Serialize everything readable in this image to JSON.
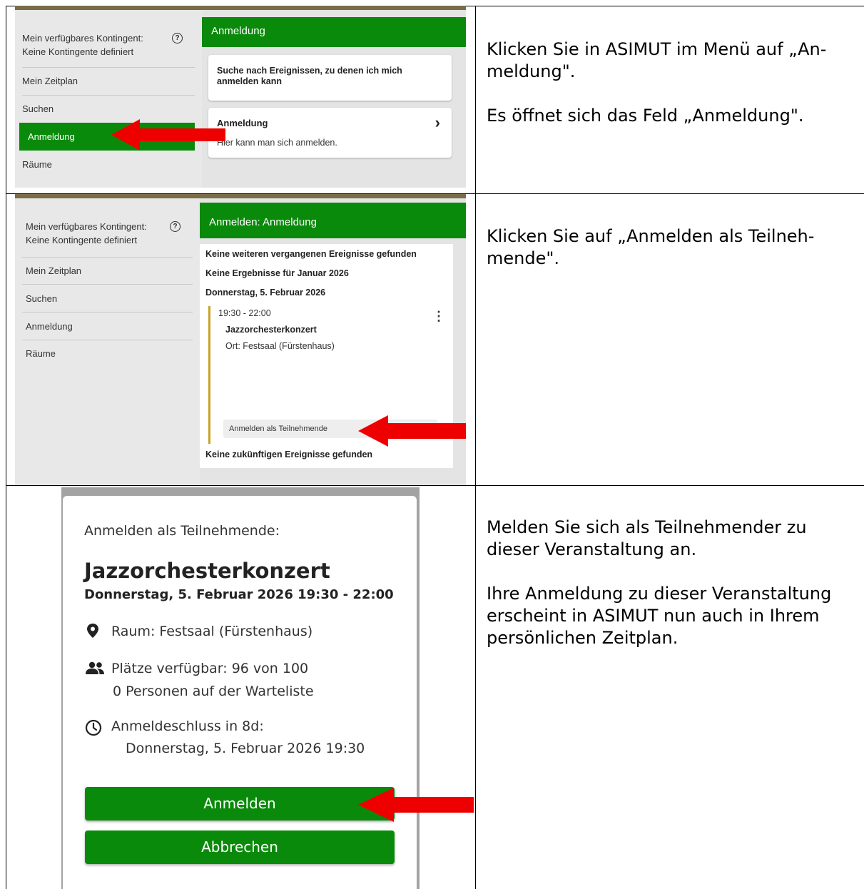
{
  "row1": {
    "sidebar": {
      "quota_line1": "Mein verfügbares Kontingent:",
      "quota_line2": "Keine Kontingente definiert",
      "items": [
        "Mein Zeitplan",
        "Suchen",
        "Anmeldung",
        "Räume"
      ]
    },
    "header": "Anmeldung",
    "card1_title": "Suche nach Ereignissen, zu denen ich mich anmelden kann",
    "card2_title": "Anmeldung",
    "card2_chevron": "›",
    "card2_desc": "Hier kann man sich anmelden.",
    "instruction": "Klicken Sie in ASIMUT im Menü auf „An-\nmeldung\".",
    "instruction2": "Es öffnet sich das Feld „Anmeldung\"."
  },
  "row2": {
    "sidebar": {
      "quota_line1": "Mein verfügbares Kontingent:",
      "quota_line2": "Keine Kontingente definiert",
      "items": [
        "Mein Zeitplan",
        "Suchen",
        "Anmeldung",
        "Räume"
      ]
    },
    "header": "Anmelden: Anmeldung",
    "no_past": "Keine weiteren vergangenen Ereignisse gefunden",
    "no_results": "Keine Ergebnisse für Januar 2026",
    "date": "Donnerstag, 5. Februar 2026",
    "event_time": "19:30 - 22:00",
    "event_title": "Jazzorchesterkonzert",
    "event_location": "Ort: Festsaal (Fürstenhaus)",
    "register_button": "Anmelden als Teilnehmende",
    "no_future": "Keine zukünftigen Ereignisse gefunden",
    "instruction": "Klicken Sie auf „Anmelden als Teilneh-\nmende\"."
  },
  "row3": {
    "dialog": {
      "heading": "Anmelden als Teilnehmende:",
      "title": "Jazzorchesterkonzert",
      "datetime": "Donnerstag, 5. Februar 2026 19:30 - 22:00",
      "room": "Raum: Festsaal (Fürstenhaus)",
      "seats": "Plätze verfügbar: 96 von 100",
      "waitlist": "0 Personen auf der Warteliste",
      "deadline": "Anmeldeschluss in 8d:",
      "deadline_date": "Donnerstag, 5. Februar 2026 19:30",
      "submit": "Anmelden",
      "cancel": "Abbrechen"
    },
    "instruction": "Melden Sie sich als Teilnehmender zu\ndieser Veranstaltung an.",
    "instruction2": "Ihre Anmeldung zu dieser Veranstaltung\nerscheint in ASIMUT nun auch in Ihrem\npersönlichen Zeitplan."
  },
  "colors": {
    "green": "#0a8a0a",
    "arrow": "#ee0000",
    "topbar": "#7b6c48"
  },
  "icons": [
    "help-icon",
    "chevron-right-icon",
    "more-vertical-icon",
    "location-pin-icon",
    "people-icon",
    "clock-icon"
  ]
}
